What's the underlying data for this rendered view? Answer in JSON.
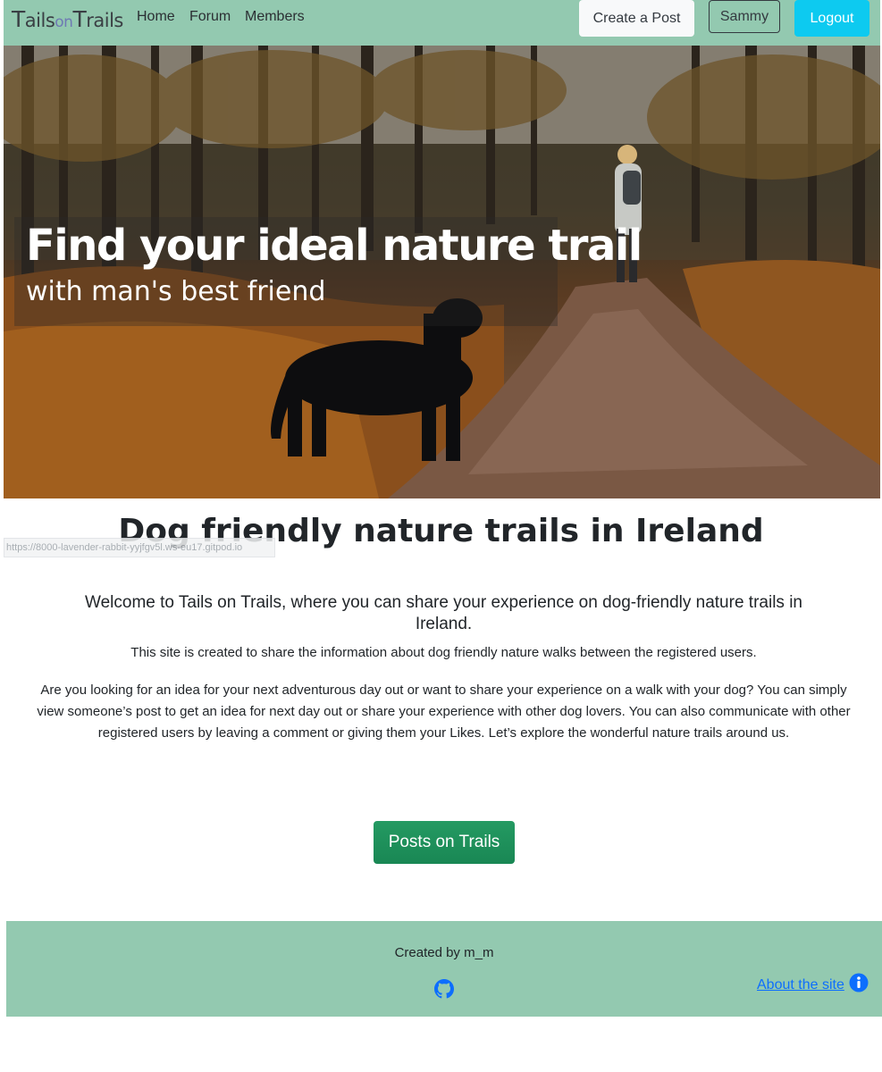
{
  "navbar": {
    "brand": {
      "t1": "T",
      "p1": "ails",
      "p2": "on",
      "t2": "T",
      "p3": "rails"
    },
    "links": [
      {
        "label": "Home"
      },
      {
        "label": "Forum"
      },
      {
        "label": "Members"
      }
    ],
    "create_post_label": "Create a Post",
    "user_label": "Sammy",
    "logout_label": "Logout",
    "colors": {
      "background": "#93c9b0",
      "logout": "#0dcaf0"
    }
  },
  "hero": {
    "title": "Find your ideal nature trail",
    "subtitle": "with man's best friend"
  },
  "main": {
    "title": "Dog friendly nature trails in Ireland",
    "welcome": "Welcome to Tails on Trails, where you can share your experience on dog-friendly nature trails in Ireland.",
    "description_1": "This site is created to share the information about dog friendly nature walks between the registered users.",
    "description_2": "Are you looking for an idea for your next adventurous day out or want to share your experience on a walk with your dog? You can simply view someone’s post to get an idea for next day out or share your experience with other dog lovers. You can also communicate with other registered users by leaving a comment or giving them your Likes. Let’s explore the wonderful nature trails around us.",
    "posts_button_label": "Posts on Trails",
    "posts_button_color": "#198754"
  },
  "status_bar": {
    "url": "https://8000-lavender-rabbit-yyjfgv5l.ws-eu17.gitpod.io"
  },
  "footer": {
    "created_by": "Created by m_m",
    "about_label": "About the site",
    "icons": {
      "github": "github-icon",
      "info": "info-circle-icon"
    }
  }
}
